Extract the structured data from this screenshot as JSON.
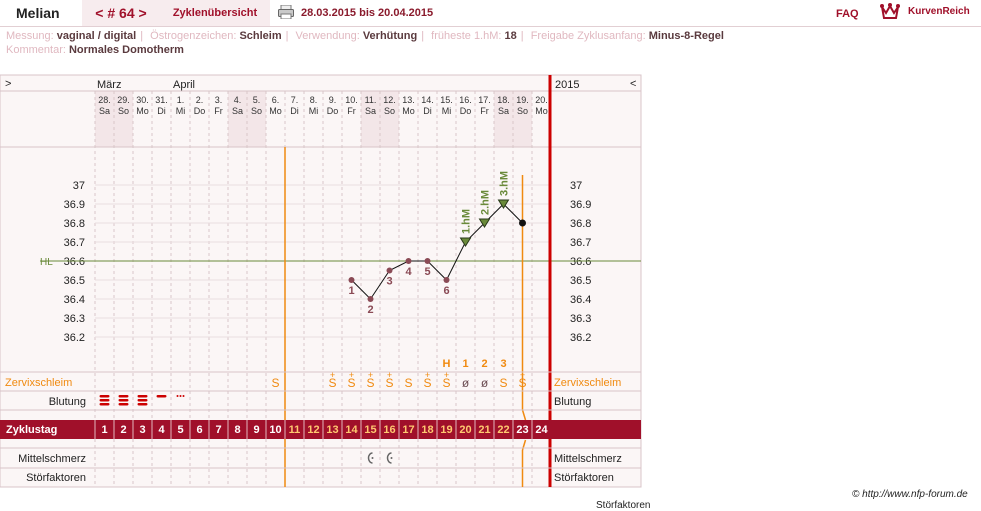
{
  "header": {
    "user": "Melian",
    "cycle_nav": "< # 64 >",
    "overview": "Zyklenübersicht",
    "print_icon": "printer-icon",
    "date_range": "28.03.2015 bis 20.04.2015",
    "faq": "FAQ",
    "logo_text": "KurvenReich",
    "logo_icon": "crown-icon"
  },
  "meta_line1": [
    {
      "k": "Messung:",
      "v": "vaginal / digital"
    },
    {
      "k": "Östrogenzeichen:",
      "v": "Schleim"
    },
    {
      "k": "Verwendung:",
      "v": "Verhütung"
    },
    {
      "k": "früheste 1.hM:",
      "v": "18"
    },
    {
      "k": "Freigabe Zyklusanfang:",
      "v": "Minus-8-Regel"
    }
  ],
  "meta_line2": [
    {
      "k": "Kommentar:",
      "v": "Normales Domotherm"
    }
  ],
  "chart": {
    "nav_left": ">",
    "nav_right": "<",
    "year": "2015",
    "months": [
      {
        "label": "März",
        "day_index": 0
      },
      {
        "label": "April",
        "day_index": 4
      }
    ],
    "days": [
      {
        "d": "28.",
        "w": "Sa",
        "we": true
      },
      {
        "d": "29.",
        "w": "So",
        "we": true
      },
      {
        "d": "30.",
        "w": "Mo",
        "we": false
      },
      {
        "d": "31.",
        "w": "Di",
        "we": false
      },
      {
        "d": "1.",
        "w": "Mi",
        "we": false
      },
      {
        "d": "2.",
        "w": "Do",
        "we": false
      },
      {
        "d": "3.",
        "w": "Fr",
        "we": false
      },
      {
        "d": "4.",
        "w": "Sa",
        "we": true
      },
      {
        "d": "5.",
        "w": "So",
        "we": true
      },
      {
        "d": "6.",
        "w": "Mo",
        "we": false
      },
      {
        "d": "7.",
        "w": "Di",
        "we": false
      },
      {
        "d": "8.",
        "w": "Mi",
        "we": false
      },
      {
        "d": "9.",
        "w": "Do",
        "we": false
      },
      {
        "d": "10.",
        "w": "Fr",
        "we": false
      },
      {
        "d": "11.",
        "w": "Sa",
        "we": true
      },
      {
        "d": "12.",
        "w": "So",
        "we": true
      },
      {
        "d": "13.",
        "w": "Mo",
        "we": false
      },
      {
        "d": "14.",
        "w": "Di",
        "we": false
      },
      {
        "d": "15.",
        "w": "Mi",
        "we": false
      },
      {
        "d": "16.",
        "w": "Do",
        "we": false
      },
      {
        "d": "17.",
        "w": "Fr",
        "we": false
      },
      {
        "d": "18.",
        "w": "Sa",
        "we": true
      },
      {
        "d": "19.",
        "w": "So",
        "we": true
      },
      {
        "d": "20.",
        "w": "Mo",
        "we": false
      }
    ],
    "y_ticks": [
      "37",
      "36.9",
      "36.8",
      "36.7",
      "36.6",
      "36.5",
      "36.4",
      "36.3",
      "36.2"
    ],
    "hl_label": "HL",
    "hl_value": 36.6,
    "temps": [
      {
        "day": 13,
        "t": 36.5,
        "label": "1",
        "mark": "dot"
      },
      {
        "day": 14,
        "t": 36.4,
        "label": "2",
        "mark": "dot"
      },
      {
        "day": 15,
        "t": 36.55,
        "label": "3",
        "mark": "dot"
      },
      {
        "day": 16,
        "t": 36.6,
        "label": "4",
        "mark": "dot"
      },
      {
        "day": 17,
        "t": 36.6,
        "label": "5",
        "mark": "dot"
      },
      {
        "day": 18,
        "t": 36.5,
        "label": "6",
        "mark": "dot"
      },
      {
        "day": 19,
        "t": 36.7,
        "label": "1.hM",
        "mark": "tri"
      },
      {
        "day": 20,
        "t": 36.8,
        "label": "2.hM",
        "mark": "tri"
      },
      {
        "day": 21,
        "t": 36.9,
        "label": "3.hM",
        "mark": "tri"
      },
      {
        "day": 22,
        "t": 36.8,
        "label": "",
        "mark": "black"
      }
    ],
    "peak_markers": [
      {
        "day": 18,
        "label": "H"
      },
      {
        "day": 19,
        "label": "1"
      },
      {
        "day": 20,
        "label": "2"
      },
      {
        "day": 21,
        "label": "3"
      }
    ],
    "cervix_label": "Zervixschleim",
    "cervix": [
      {
        "day": 9,
        "s": "S"
      },
      {
        "day": 12,
        "s": "S+"
      },
      {
        "day": 13,
        "s": "S+"
      },
      {
        "day": 14,
        "s": "S+"
      },
      {
        "day": 15,
        "s": "S+"
      },
      {
        "day": 16,
        "s": "S"
      },
      {
        "day": 17,
        "s": "S+"
      },
      {
        "day": 18,
        "s": "S+"
      },
      {
        "day": 19,
        "s": "ø"
      },
      {
        "day": 20,
        "s": "ø"
      },
      {
        "day": 21,
        "s": "S"
      },
      {
        "day": 22,
        "s": "S+"
      }
    ],
    "bleeding_label": "Blutung",
    "bleeding": [
      {
        "day": 0,
        "level": 3
      },
      {
        "day": 1,
        "level": 3
      },
      {
        "day": 2,
        "level": 3
      },
      {
        "day": 3,
        "level": 1
      },
      {
        "day": 4,
        "level": 0
      }
    ],
    "cycle_label": "Zyklustag",
    "cycle_days": [
      "1",
      "2",
      "3",
      "4",
      "5",
      "6",
      "7",
      "8",
      "9",
      "10",
      "11",
      "12",
      "13",
      "14",
      "15",
      "16",
      "17",
      "18",
      "19",
      "20",
      "21",
      "22",
      "23",
      "24"
    ],
    "pain_label": "Mittelschmerz",
    "pain_days": [
      14,
      15
    ],
    "pain_icon": "mittelschmerz-icon",
    "disturb_label": "Störfaktoren",
    "fertile_start_day": 10,
    "fertile_end_day": 22
  },
  "colors": {
    "accent": "#a0102a",
    "orange": "#f08a10",
    "green": "#6a8a3a",
    "mauve": "#8a4a55",
    "weekend": "#f3e6e8",
    "bg": "#fbf6f6"
  },
  "footer": "© http://www.nfp-forum.de",
  "cutoff_text": "Störfaktoren"
}
